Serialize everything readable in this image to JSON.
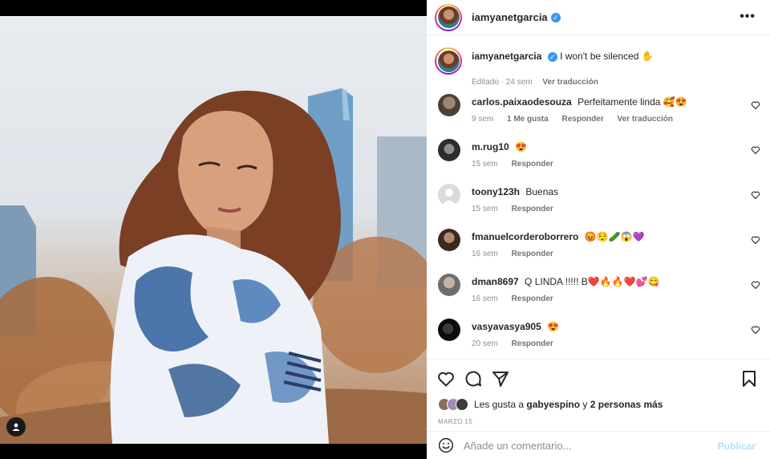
{
  "post": {
    "username": "iamyanetgarcia",
    "verified_badge": "✓",
    "more_icon": "ellipsis-icon",
    "more_label": "•••"
  },
  "caption": {
    "username": "iamyanetgarcia",
    "text": "I won't be silenced ✋",
    "edited": "Editado · 24 sem",
    "translate": "Ver traducción"
  },
  "comments": [
    {
      "user": "carlos.paixaodesouza",
      "text": "Perfeitamente linda 🥰😍",
      "time": "9 sem",
      "likes": "1 Me gusta",
      "reply": "Responder",
      "translate": "Ver traducción"
    },
    {
      "user": "m.rug10",
      "text": "😍",
      "time": "15 sem",
      "reply": "Responder"
    },
    {
      "user": "toony123h",
      "text": "Buenas",
      "time": "15 sem",
      "reply": "Responder"
    },
    {
      "user": "fmanuelcorderoborrero",
      "text": "😡😌🥒😱💜",
      "time": "16 sem",
      "reply": "Responder"
    },
    {
      "user": "dman8697",
      "text": "Q LINDA !!!!! B❤️🔥🔥❤️💕😋",
      "time": "16 sem",
      "reply": "Responder"
    },
    {
      "user": "vasyavasya905",
      "text": "😍",
      "time": "20 sem",
      "reply": "Responder"
    }
  ],
  "likes": {
    "prefix": "Les gusta a",
    "user": "gabyespino",
    "connector": "y",
    "others": "2 personas más"
  },
  "date": "MARZO 15",
  "comment_box": {
    "placeholder": "Añade un comentario...",
    "publish": "Publicar"
  },
  "colors": {
    "accent": "#0095f6",
    "publish_disabled": "#b2dffc",
    "verified": "#3897f0"
  }
}
